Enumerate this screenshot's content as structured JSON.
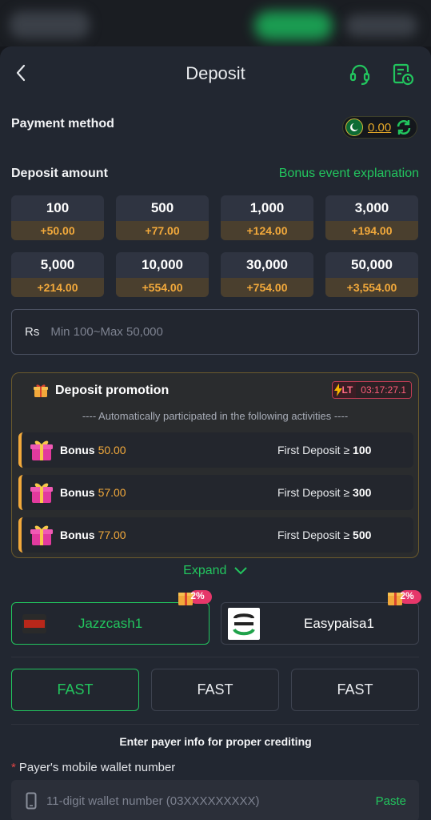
{
  "header": {
    "title": "Deposit"
  },
  "payment_method": {
    "label": "Payment method",
    "balance": "0.00"
  },
  "deposit_amount": {
    "label": "Deposit amount",
    "bonus_link": "Bonus event explanation",
    "options": [
      {
        "value": "100",
        "bonus": "+50.00"
      },
      {
        "value": "500",
        "bonus": "+77.00"
      },
      {
        "value": "1,000",
        "bonus": "+124.00"
      },
      {
        "value": "3,000",
        "bonus": "+194.00"
      },
      {
        "value": "5,000",
        "bonus": "+214.00"
      },
      {
        "value": "10,000",
        "bonus": "+554.00"
      },
      {
        "value": "30,000",
        "bonus": "+754.00"
      },
      {
        "value": "50,000",
        "bonus": "+3,554.00"
      }
    ],
    "currency": "Rs",
    "placeholder": "Min 100~Max 50,000"
  },
  "promotion": {
    "title": "Deposit promotion",
    "badge_label": "LT",
    "countdown": "03:17:27.1",
    "subtitle": "---- Automatically participated in the following activities ----",
    "items": [
      {
        "label": "Bonus",
        "amount": "50.00",
        "condition": "First Deposit ≥",
        "threshold": "100"
      },
      {
        "label": "Bonus",
        "amount": "57.00",
        "condition": "First Deposit ≥",
        "threshold": "300"
      },
      {
        "label": "Bonus",
        "amount": "77.00",
        "condition": "First Deposit ≥",
        "threshold": "500"
      }
    ]
  },
  "expand_label": "Expand",
  "channels": [
    {
      "name": "Jazzcash1",
      "badge": "2%",
      "logo_text": "JazzCash",
      "selected": true
    },
    {
      "name": "Easypaisa1",
      "badge": "2%",
      "selected": false
    }
  ],
  "speed_options": [
    {
      "label": "FAST",
      "selected": true
    },
    {
      "label": "FAST",
      "selected": false
    },
    {
      "label": "FAST",
      "selected": false
    }
  ],
  "payer": {
    "title": "Enter payer info for proper crediting",
    "required_mark": "*",
    "wallet_label": "Payer's mobile wallet number",
    "wallet_placeholder": "11-digit wallet number (03XXXXXXXXX)",
    "paste_label": "Paste"
  },
  "colors": {
    "accent": "#22c55e",
    "bonus": "#f2a93b",
    "background": "#222731",
    "alert": "#ff5d7a"
  }
}
